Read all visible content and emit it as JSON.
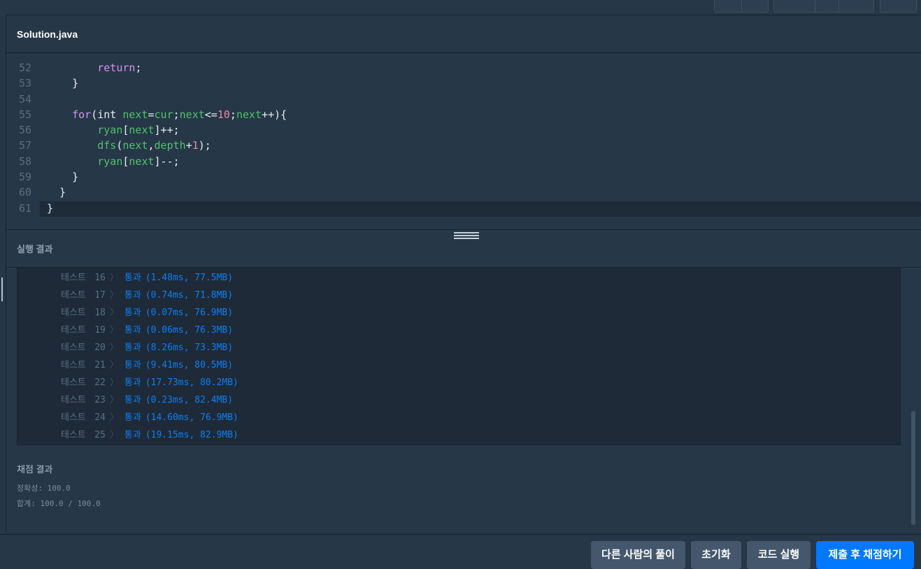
{
  "editor": {
    "filename": "Solution.java",
    "lines": [
      {
        "n": "52",
        "html": "        <span class=\"kw\">return</span>;"
      },
      {
        "n": "53",
        "html": "    }"
      },
      {
        "n": "54",
        "html": ""
      },
      {
        "n": "55",
        "html": "    <span class=\"kw\">for</span>(<span class=\"ty\">int</span> <span class=\"id\">next</span>=<span class=\"id\">cur</span>;<span class=\"id\">next</span>&lt;=<span class=\"num\">10</span>;<span class=\"id\">next</span>++){"
      },
      {
        "n": "56",
        "html": "        <span class=\"id\">ryan</span>[<span class=\"id\">next</span>]++;"
      },
      {
        "n": "57",
        "html": "        <span class=\"id\">dfs</span>(<span class=\"id\">next</span>,<span class=\"id\">depth</span>+<span class=\"num\">1</span>);"
      },
      {
        "n": "58",
        "html": "        <span class=\"id\">ryan</span>[<span class=\"id\">next</span>]--;"
      },
      {
        "n": "59",
        "html": "    }"
      },
      {
        "n": "60",
        "html": "  }"
      },
      {
        "n": "61",
        "html": "}"
      }
    ]
  },
  "results": {
    "title": "실행 결과",
    "test_label": "테스트",
    "arrow": "〉",
    "tests": [
      {
        "num": "16",
        "status": "통과",
        "detail": "(1.48ms, 77.5MB)"
      },
      {
        "num": "17",
        "status": "통과",
        "detail": "(0.74ms, 71.8MB)"
      },
      {
        "num": "18",
        "status": "통과",
        "detail": "(0.07ms, 76.9MB)"
      },
      {
        "num": "19",
        "status": "통과",
        "detail": "(0.06ms, 76.3MB)"
      },
      {
        "num": "20",
        "status": "통과",
        "detail": "(8.26ms, 73.3MB)"
      },
      {
        "num": "21",
        "status": "통과",
        "detail": "(9.41ms, 80.5MB)"
      },
      {
        "num": "22",
        "status": "통과",
        "detail": "(17.73ms, 80.2MB)"
      },
      {
        "num": "23",
        "status": "통과",
        "detail": "(0.23ms, 82.4MB)"
      },
      {
        "num": "24",
        "status": "통과",
        "detail": "(14.60ms, 76.9MB)"
      },
      {
        "num": "25",
        "status": "통과",
        "detail": "(19.15ms, 82.9MB)"
      }
    ],
    "grading": {
      "title": "채점 결과",
      "accuracy": "정확성: 100.0",
      "total": "합계: 100.0 / 100.0"
    }
  },
  "buttons": {
    "others_solution": "다른 사람의 풀이",
    "reset": "초기화",
    "run_code": "코드 실행",
    "submit": "제출 후 채점하기"
  },
  "colors": {
    "background": "#263747",
    "submit": "#0078ff",
    "pass": "#0d7ff2"
  }
}
